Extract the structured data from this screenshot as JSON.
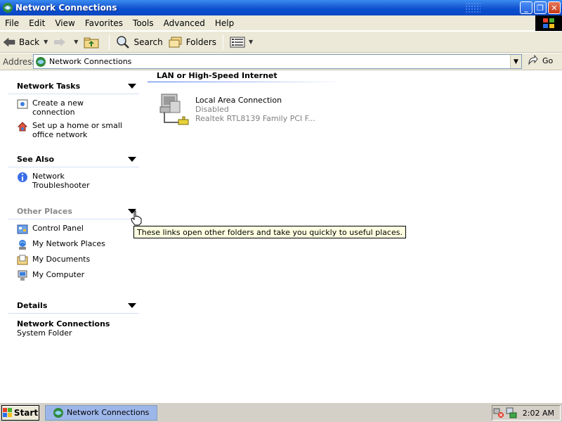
{
  "window": {
    "title": "Network Connections",
    "controls": {
      "minimize": "_",
      "maximize": "❐",
      "close": "✕"
    }
  },
  "menu": [
    "File",
    "Edit",
    "View",
    "Favorites",
    "Tools",
    "Advanced",
    "Help"
  ],
  "toolbar": {
    "back": "Back",
    "search": "Search",
    "folders": "Folders"
  },
  "address": {
    "label": "Address",
    "value": "Network Connections",
    "go": "Go"
  },
  "left_pane": {
    "network_tasks": {
      "title": "Network Tasks",
      "items": [
        "Create a new connection",
        "Set up a home or small office network"
      ]
    },
    "see_also": {
      "title": "See Also",
      "items": [
        "Network Troubleshooter"
      ]
    },
    "other_places": {
      "title": "Other Places",
      "items": [
        "Control Panel",
        "My Network Places",
        "My Documents",
        "My Computer"
      ]
    },
    "details": {
      "title": "Details",
      "name": "Network Connections",
      "type": "System Folder"
    }
  },
  "content": {
    "group_title": "LAN or High-Speed Internet",
    "connection": {
      "name": "Local Area Connection",
      "status": "Disabled",
      "device": "Realtek RTL8139 Family PCI F..."
    }
  },
  "tooltip": "These links open other folders and take you quickly to useful places.",
  "taskbar": {
    "start": "Start",
    "task": "Network Connections",
    "time": "2:02 AM"
  }
}
